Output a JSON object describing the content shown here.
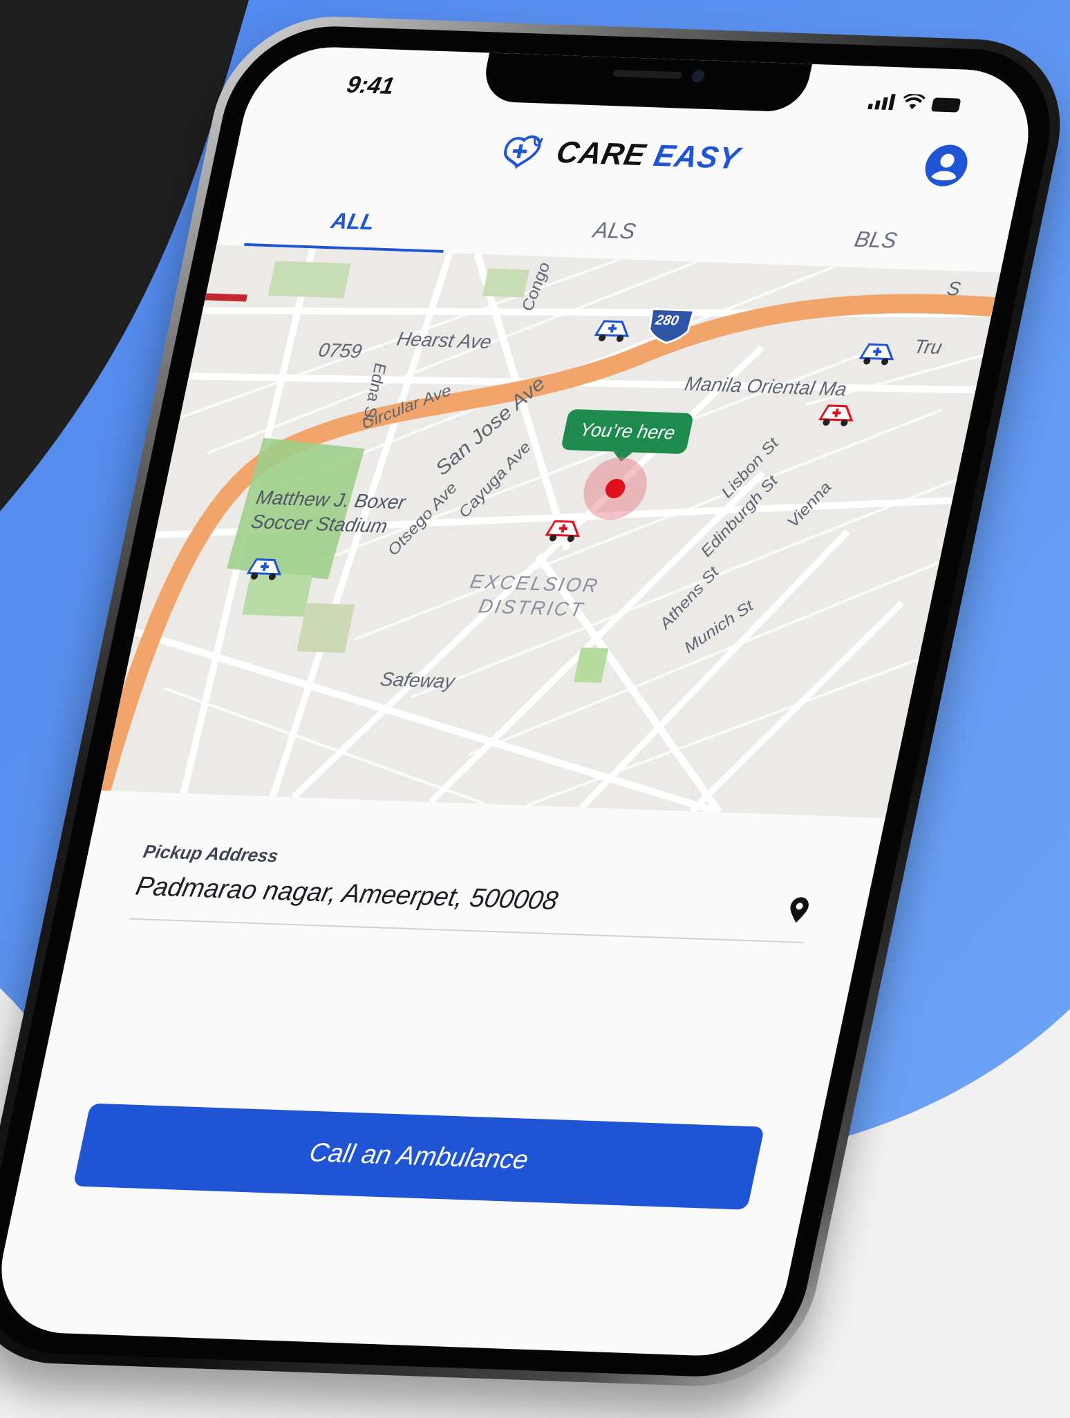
{
  "status_bar": {
    "time": "9:41"
  },
  "header": {
    "brand_part1": "CARE",
    "brand_part2": "EASY"
  },
  "tabs": [
    {
      "label": "ALL",
      "active": true
    },
    {
      "label": "ALS",
      "active": false
    },
    {
      "label": "BLS",
      "active": false
    }
  ],
  "map": {
    "you_are_here": "You’re here",
    "labels": {
      "congo": "Congo",
      "hearst": "Hearst Ave",
      "hwy": "0759",
      "edna": "Edna St",
      "circular": "Circular Ave",
      "san_jose": "San Jose Ave",
      "manila": "Manila Oriental Ma",
      "tru": "Tru",
      "stadium_line1": "Matthew J. Boxer",
      "stadium_line2": "Soccer Stadium",
      "otsego": "Otsego Ave",
      "cayuga": "Cayuga Ave",
      "lisbon": "Lisbon St",
      "edinburgh": "Edinburgh St",
      "vienna": "Vienna",
      "excelsior_line1": "EXCELSIOR",
      "excelsior_line2": "DISTRICT",
      "athens": "Athens St",
      "munich": "Munich St",
      "safeway": "Safeway",
      "interstate": "280",
      "corner": "S"
    }
  },
  "pickup": {
    "label": "Pickup Address",
    "value": "Padmarao nagar, Ameerpet, 500008"
  },
  "cta": {
    "label": "Call an Ambulance"
  },
  "colors": {
    "brand_blue": "#1f54d4",
    "bg_blue": "#5e95f0",
    "here_green": "#1e8a4e",
    "pin_red": "#e20f1f",
    "road_orange": "#f2a56b"
  },
  "icons": [
    "care-easy-logo-icon",
    "user-profile-icon",
    "location-pin-icon",
    "ambulance-icon",
    "signal-icon",
    "wifi-icon",
    "battery-icon"
  ]
}
